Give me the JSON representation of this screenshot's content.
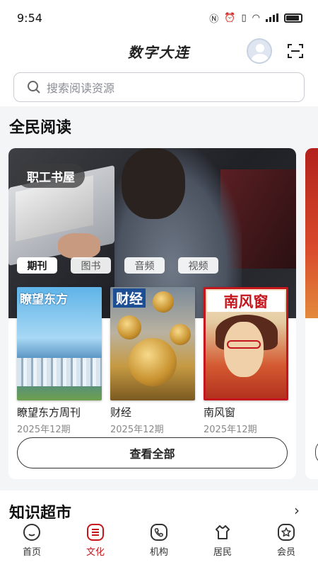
{
  "status_bar": {
    "time": "9:54"
  },
  "header": {
    "title": "数字大连"
  },
  "search": {
    "placeholder": "搜索阅读资源"
  },
  "section_reading": {
    "title": "全民阅读",
    "card": {
      "badge": "职工书屋",
      "tabs": [
        {
          "label": "期刊",
          "active": true
        },
        {
          "label": "图书",
          "active": false
        },
        {
          "label": "音频",
          "active": false
        },
        {
          "label": "视频",
          "active": false
        }
      ],
      "items": [
        {
          "title": "瞭望东方周刊",
          "date": "2025年12期",
          "cover_text": "瞭望东方"
        },
        {
          "title": "财经",
          "date": "2025年12期",
          "cover_text": "财经"
        },
        {
          "title": "南风窗",
          "date": "2025年12期",
          "cover_text": "南风窗"
        }
      ],
      "view_all": "查看全部"
    }
  },
  "section_knowledge": {
    "title": "知识超市",
    "arrow": "›"
  },
  "tabbar": [
    {
      "label": "首页",
      "icon": "home-icon",
      "active": false
    },
    {
      "label": "文化",
      "icon": "culture-icon",
      "active": true
    },
    {
      "label": "机构",
      "icon": "phone-icon",
      "active": false
    },
    {
      "label": "居民",
      "icon": "resident-icon",
      "active": false
    },
    {
      "label": "会员",
      "icon": "member-icon",
      "active": false
    }
  ],
  "colors": {
    "accent": "#c4161c",
    "text": "#222222",
    "muted": "#888888"
  }
}
